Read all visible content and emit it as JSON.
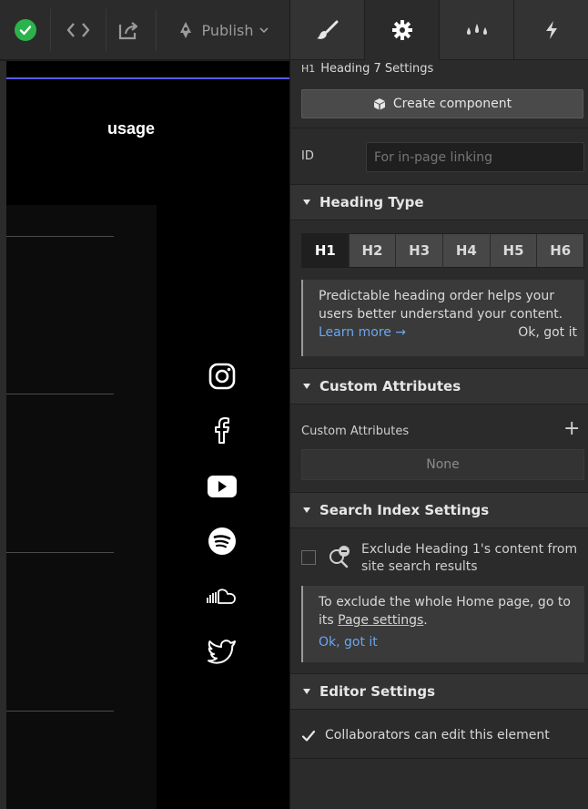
{
  "toolbar": {
    "publish_label": "Publish"
  },
  "canvas": {
    "usage_text": "usage"
  },
  "panel": {
    "selected": {
      "tag": "H1",
      "title": "Heading 7 Settings"
    },
    "create_component_label": "Create component",
    "id_field": {
      "label": "ID",
      "placeholder": "For in-page linking"
    },
    "heading_type": {
      "title": "Heading Type",
      "levels": [
        "H1",
        "H2",
        "H3",
        "H4",
        "H5",
        "H6"
      ],
      "selected": "H1",
      "hint": {
        "text": "Predictable heading order helps your users better understand your content.",
        "learn_more": "Learn more →",
        "dismiss": "Ok, got it"
      }
    },
    "custom_attributes": {
      "title": "Custom Attributes",
      "label": "Custom Attributes",
      "add": "+",
      "empty": "None"
    },
    "search_index": {
      "title": "Search Index Settings",
      "exclude_label": "Exclude Heading 1's content from site search results",
      "hint": {
        "text_before": "To exclude the whole Home page, go to its ",
        "link_text": "Page settings",
        "text_after": ".",
        "dismiss": "Ok, got it"
      }
    },
    "editor_settings": {
      "title": "Editor Settings",
      "collab_label": "Collaborators can edit this element",
      "collab_checked": true
    }
  },
  "colors": {
    "accent_line": "#5a5cf0",
    "status_green": "#2bb24c",
    "link_blue": "#6aa6f0"
  }
}
